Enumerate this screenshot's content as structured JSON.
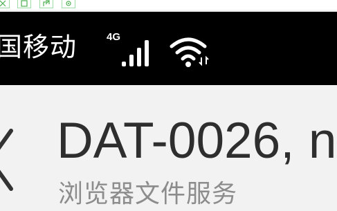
{
  "status_bar": {
    "carrier": "国移动",
    "network_type": "4G",
    "signal_icon": "cellular-signal-icon",
    "wifi_icon": "wifi-icon"
  },
  "toolbar": {
    "icons": [
      "expand-icon",
      "save-icon",
      "share-icon",
      "settings-icon"
    ]
  },
  "header": {
    "title": "DAT-0026, n",
    "subtitle": "浏览器文件服务",
    "back_icon": "back-chevron-icon"
  },
  "colors": {
    "status_bar_bg": "#000000",
    "header_bg": "#f2f2f2",
    "title_color": "#2e2e2e",
    "subtitle_color": "#8c8c8c",
    "toolbar_border": "#9fdca8"
  }
}
